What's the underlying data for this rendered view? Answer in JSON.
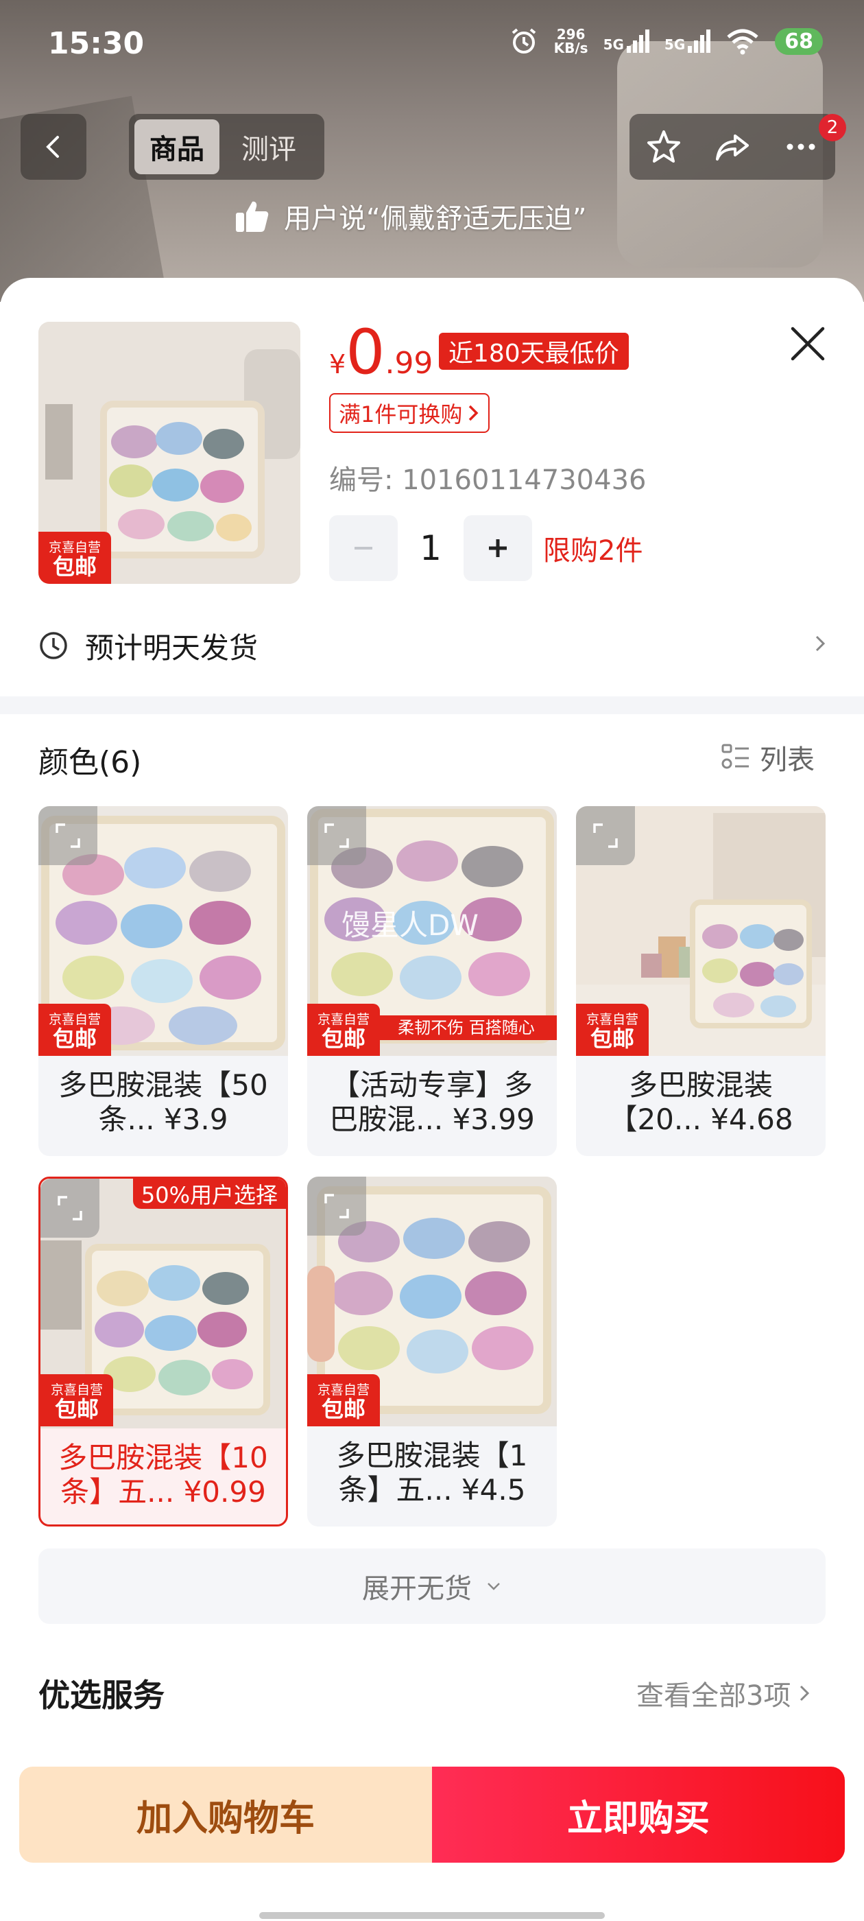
{
  "status_bar": {
    "time": "15:30",
    "net_speed_value": "296",
    "net_speed_unit": "KB/s",
    "signal1": "5G",
    "signal2": "5G",
    "battery": "68",
    "icons": [
      "alarm-icon",
      "signal-icon",
      "wifi-icon",
      "battery-icon"
    ]
  },
  "header": {
    "tabs": [
      {
        "label": "商品",
        "active": true
      },
      {
        "label": "测评",
        "active": false
      }
    ],
    "more_badge": "2",
    "review_tip": "用户说“佩戴舒适无压迫”",
    "icons": [
      "back-icon",
      "star-icon",
      "share-icon",
      "more-icon",
      "thumbs-up-icon"
    ]
  },
  "product": {
    "currency": "¥",
    "price_int": "0",
    "price_dec": ".99",
    "low_price_tag": "近180天最低价",
    "swap_tag": "满1件可换购",
    "sku_number": "编号: 10160114730436",
    "quantity": "1",
    "limit": "限购2件",
    "jx_tag_line1": "京喜自营",
    "jx_tag_line2": "包邮"
  },
  "shipping": {
    "text": "预计明天发货"
  },
  "colors": {
    "heading": "颜色(6)",
    "list_label": "列表",
    "options": [
      {
        "label": "多巴胺混装【50条... ¥3.9",
        "selected": false,
        "tag1": "京喜自营",
        "tag2": "包邮"
      },
      {
        "label": "【活动专享】多巴胺混... ¥3.99",
        "selected": false,
        "tag1": "京喜自营",
        "tag2": "包邮",
        "watermark": "馒星人DW",
        "promo": "柔韧不伤 百搭随心"
      },
      {
        "label": "多巴胺混装【20... ¥4.68",
        "selected": false,
        "tag1": "京喜自营",
        "tag2": "包邮"
      },
      {
        "label": "多巴胺混装【10条】五... ¥0.99",
        "selected": true,
        "tag1": "京喜自营",
        "tag2": "包邮",
        "pick_tag": "50%用户选择"
      },
      {
        "label": "多巴胺混装【1条】五... ¥4.5",
        "selected": false,
        "tag1": "京喜自营",
        "tag2": "包邮"
      }
    ],
    "expand_none": "展开无货"
  },
  "services": {
    "heading": "优选服务",
    "more": "查看全部3项"
  },
  "actions": {
    "add_to_cart": "加入购物车",
    "buy_now": "立即购买"
  },
  "colors_theme": {
    "accent": "#e2231a",
    "cart_bg": "#fee3c4",
    "cart_text": "#9e4d10"
  }
}
